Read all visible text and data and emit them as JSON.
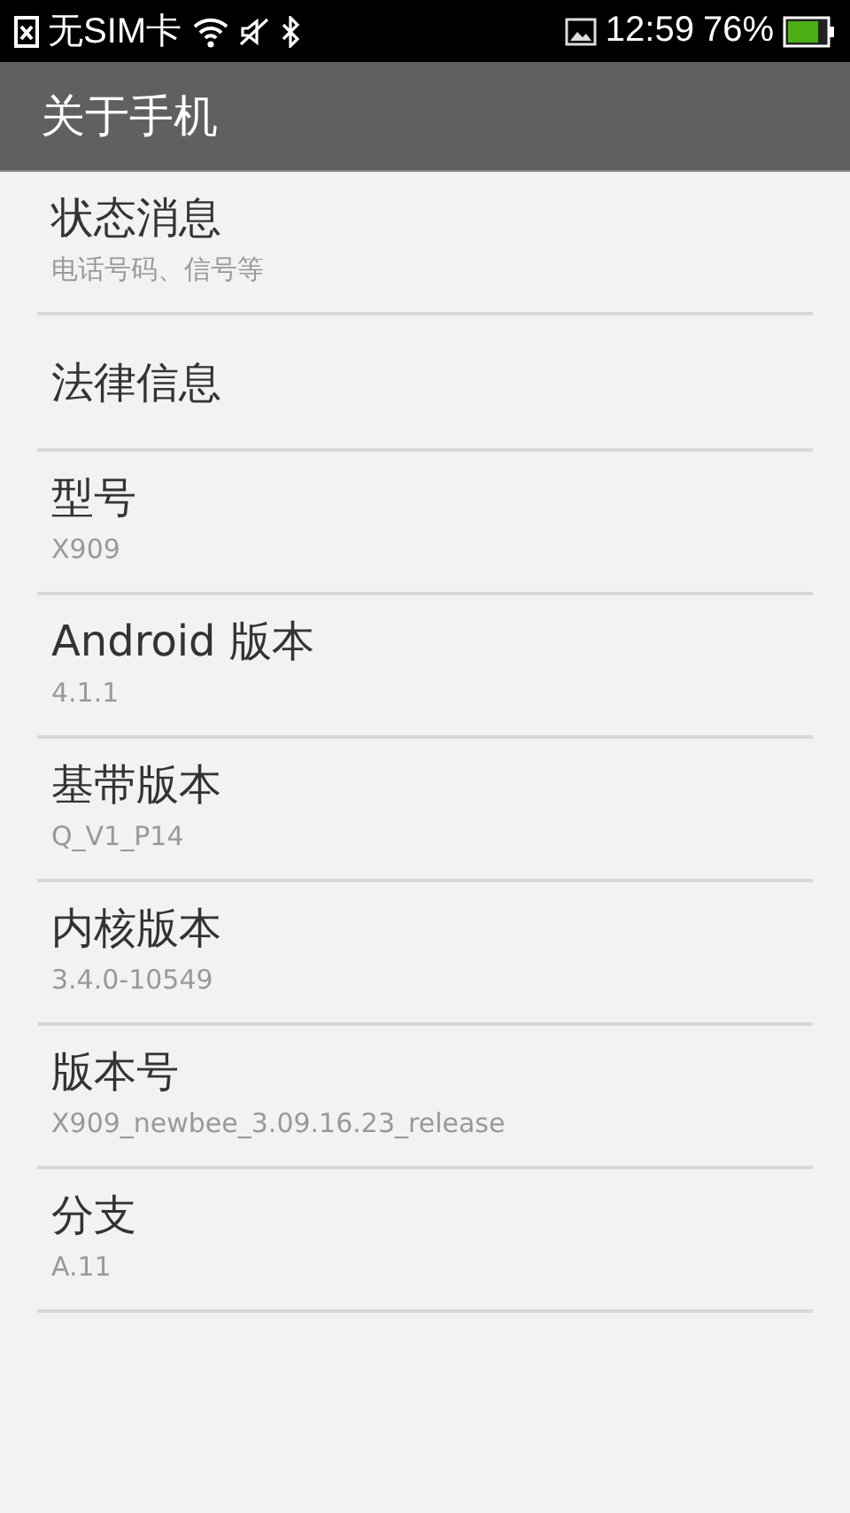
{
  "status_bar": {
    "carrier": "无SIM卡",
    "time": "12:59",
    "battery": "76%"
  },
  "header": {
    "title": "关于手机"
  },
  "items": [
    {
      "title": "状态消息",
      "summary": "电话号码、信号等"
    },
    {
      "title": "法律信息"
    },
    {
      "title": "型号",
      "summary": "X909"
    },
    {
      "title": "Android 版本",
      "summary": "4.1.1"
    },
    {
      "title": "基带版本",
      "summary": "Q_V1_P14"
    },
    {
      "title": "内核版本",
      "summary": "3.4.0-10549"
    },
    {
      "title": "版本号",
      "summary": "X909_newbee_3.09.16.23_release"
    },
    {
      "title": "分支",
      "summary": "A.11"
    }
  ]
}
